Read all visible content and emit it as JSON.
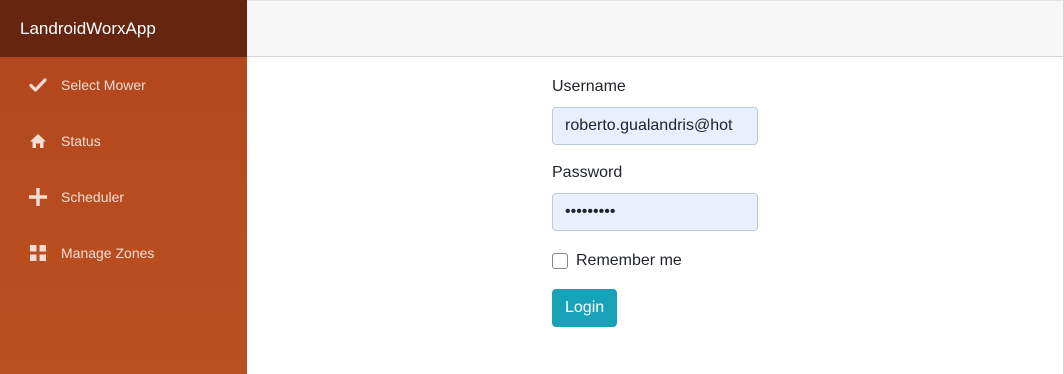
{
  "sidebar": {
    "brand": "LandroidWorxApp",
    "items": [
      {
        "label": "Select Mower",
        "icon": "check-icon"
      },
      {
        "label": "Status",
        "icon": "home-icon"
      },
      {
        "label": "Scheduler",
        "icon": "plus-icon"
      },
      {
        "label": "Manage Zones",
        "icon": "grid-icon"
      }
    ]
  },
  "login_form": {
    "username_label": "Username",
    "username_value": "roberto.gualandris@hot",
    "password_label": "Password",
    "password_value": "•••••••••",
    "remember_label": "Remember me",
    "remember_checked": false,
    "login_button": "Login"
  },
  "colors": {
    "brand_bar": "#65260f",
    "sidebar": "#b1461f",
    "button": "#17a2b8",
    "autofill": "#e8f0fe"
  }
}
